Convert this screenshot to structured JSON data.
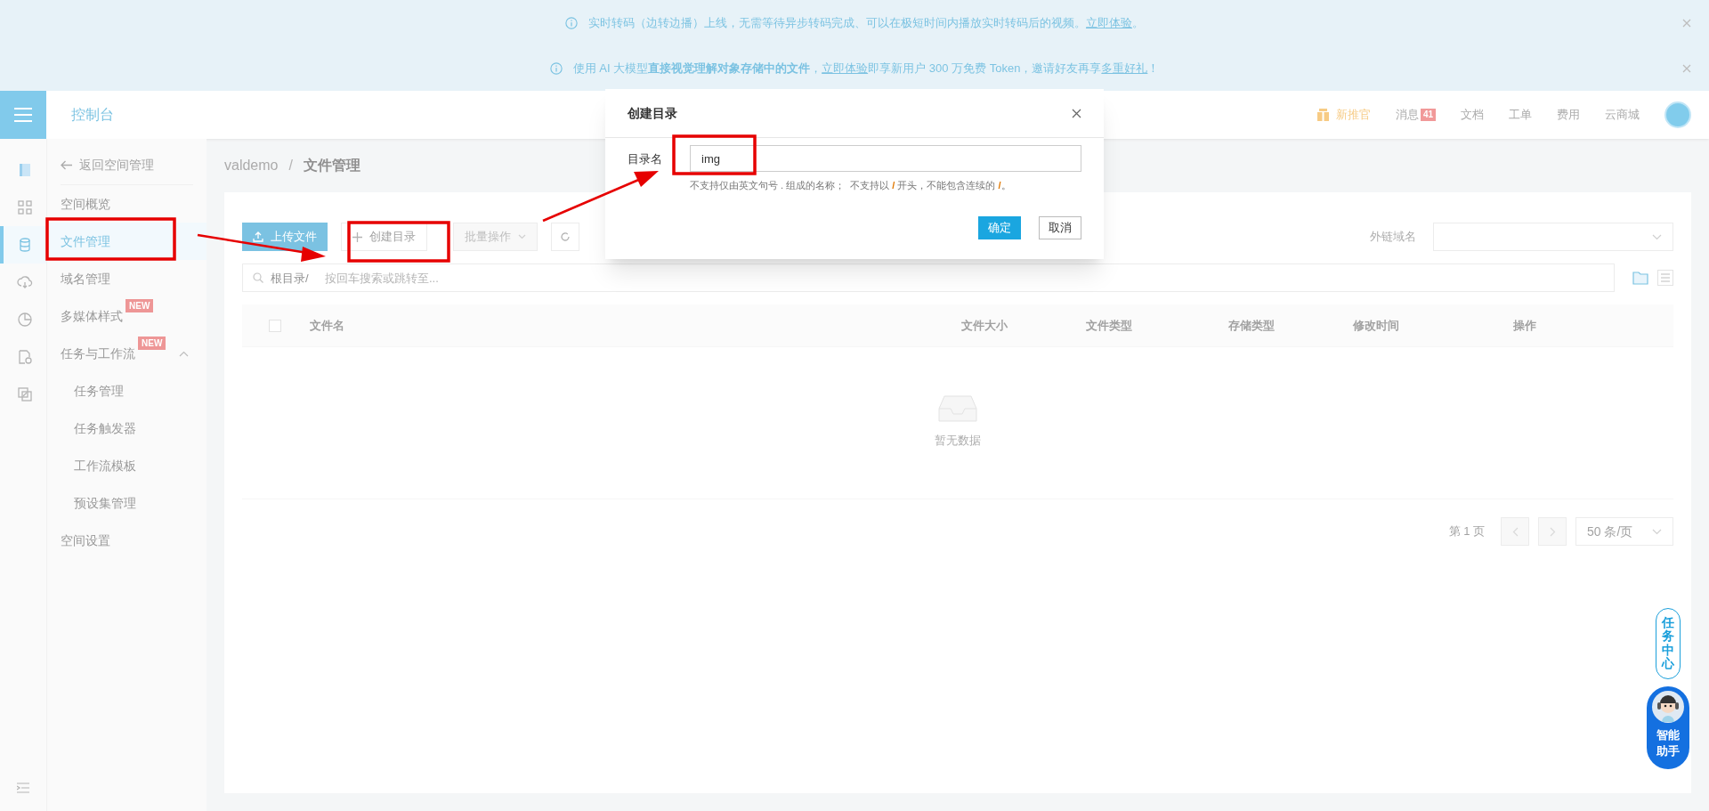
{
  "notices": [
    {
      "segments": [
        {
          "kind": "text",
          "text": "实时转码（边转边播）上线，无需等待异步转码完成、可以在极短时间内播放实时转码后的视频。"
        },
        {
          "kind": "link",
          "text": "立即体验"
        },
        {
          "kind": "text",
          "text": "。"
        }
      ]
    },
    {
      "segments": [
        {
          "kind": "text",
          "text": "使用 AI 大模型"
        },
        {
          "kind": "bold",
          "text": "直接视觉理解对象存储中的文件"
        },
        {
          "kind": "text",
          "text": "，"
        },
        {
          "kind": "link",
          "text": "立即体验"
        },
        {
          "kind": "text",
          "text": "即享新用户 300 万免费 Token，邀请好友再享"
        },
        {
          "kind": "link",
          "text": "多重好礼"
        },
        {
          "kind": "text",
          "text": "！"
        }
      ]
    }
  ],
  "header": {
    "title": "控制台",
    "promo": "新推官",
    "links": [
      {
        "label": "消息",
        "badge": "41"
      },
      {
        "label": "文档"
      },
      {
        "label": "工单"
      },
      {
        "label": "费用"
      },
      {
        "label": "云商城"
      }
    ]
  },
  "rail": [
    {
      "selected": false
    },
    {
      "selected": false
    },
    {
      "selected": true
    },
    {
      "selected": false
    },
    {
      "selected": false
    },
    {
      "selected": false
    },
    {
      "selected": false
    }
  ],
  "sidebar": {
    "back": "返回空间管理",
    "items": [
      {
        "label": "空间概览",
        "selected": false
      },
      {
        "label": "文件管理",
        "selected": true
      },
      {
        "label": "域名管理",
        "selected": false
      },
      {
        "label": "多媒体样式",
        "selected": false,
        "badge": "NEW"
      },
      {
        "label": "任务与工作流",
        "selected": false,
        "badge": "NEW",
        "expanded": true,
        "children": [
          {
            "label": "任务管理",
            "selected": false
          },
          {
            "label": "任务触发器",
            "selected": false
          },
          {
            "label": "工作流模板",
            "selected": false
          },
          {
            "label": "预设集管理",
            "selected": false
          }
        ]
      },
      {
        "label": "空间设置",
        "selected": false
      }
    ]
  },
  "breadcrumb": [
    "valdemo",
    "文件管理"
  ],
  "breadcrumb_separator": "/",
  "toolbar": {
    "buttons": [
      {
        "kind": "primary",
        "label": "上传文件"
      },
      {
        "kind": "create",
        "label": "创建目录"
      },
      {
        "kind": "dropdown",
        "label": "批量操作",
        "disabled": true
      },
      {
        "kind": "refresh"
      }
    ],
    "domain_label": "外链域名"
  },
  "search": {
    "prefix": "根目录/",
    "placeholder": "按回车搜索或跳转至..."
  },
  "table": {
    "select_all_checked": false,
    "columns": [
      "文件名",
      "文件大小",
      "文件类型",
      "存储类型",
      "修改时间",
      "操作"
    ],
    "empty": "暂无数据"
  },
  "pagination": {
    "page": "第 1 页",
    "page_size": "50 条/页"
  },
  "floating": {
    "task_center": "任务中心",
    "assistant": "智能助手"
  },
  "dialog": {
    "title": "创建目录",
    "field_label": "目录名",
    "value": "img",
    "hint": [
      {
        "text": "不支持仅由英文句号 . 组成的名称；  不支持以 ",
        "highlight": false
      },
      {
        "text": "/",
        "highlight": true
      },
      {
        "text": " 开头，不能包含连续的 ",
        "highlight": false
      },
      {
        "text": "/",
        "highlight": true
      },
      {
        "text": "。",
        "highlight": false
      }
    ],
    "buttons": [
      {
        "kind": "primary",
        "label": "确定"
      },
      {
        "kind": "default",
        "label": "取消"
      }
    ]
  }
}
